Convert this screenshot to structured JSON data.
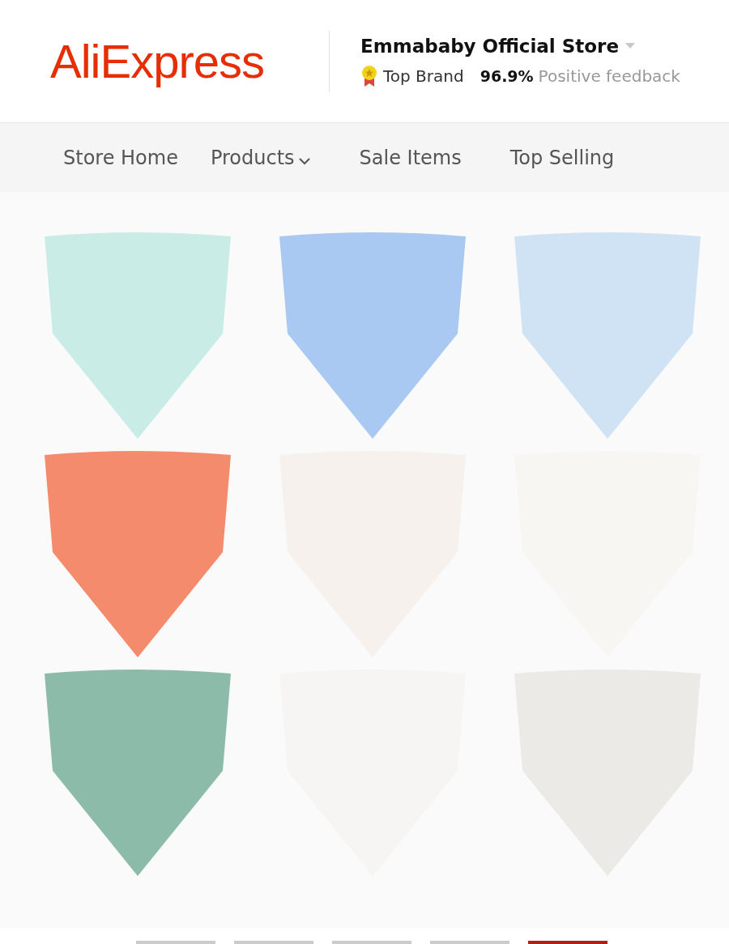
{
  "logo": "AliExpress",
  "store": {
    "name": "Emmababy Official Store",
    "badge": "Top Brand",
    "rating": "96.9%",
    "rating_label": "Positive feedback"
  },
  "nav": [
    {
      "label": "Store Home",
      "has_menu": false
    },
    {
      "label": "Products",
      "has_menu": true
    },
    {
      "label": "Sale Items",
      "has_menu": false
    },
    {
      "label": "Top Selling",
      "has_menu": false
    }
  ],
  "gallery": {
    "thumbnails": [
      {
        "selected": false
      },
      {
        "selected": false
      },
      {
        "selected": false
      },
      {
        "selected": false
      },
      {
        "selected": true
      }
    ]
  }
}
